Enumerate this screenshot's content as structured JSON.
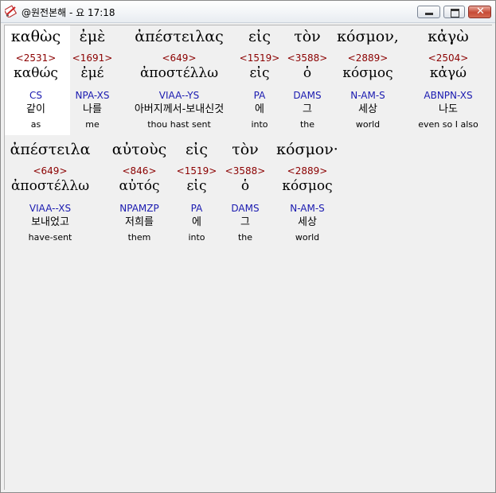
{
  "window": {
    "title": "@원전본해 - 요 17:18",
    "icon": "bible-app-icon",
    "buttons": {
      "minimize": "",
      "maximize": "",
      "close": "✕"
    }
  },
  "lines": [
    {
      "words": [
        {
          "greek": "καθὼς",
          "strong": "<2531>",
          "lemma": "καθώς",
          "morph": "CS",
          "korean": "같이",
          "english": "as"
        },
        {
          "greek": "ἐμὲ",
          "strong": "<1691>",
          "lemma": "ἐμέ",
          "morph": "NPA-XS",
          "korean": "나를",
          "english": "me"
        },
        {
          "greek": "ἀπέστειλας",
          "strong": "<649>",
          "lemma": "ἀποστέλλω",
          "morph": "VIAA--YS",
          "korean": "아버지께서-보내신것",
          "english": "thou hast sent"
        },
        {
          "greek": "εἰς",
          "strong": "<1519>",
          "lemma": "εἰς",
          "morph": "PA",
          "korean": "에",
          "english": "into"
        },
        {
          "greek": "τὸν",
          "strong": "<3588>",
          "lemma": "ὁ",
          "morph": "DAMS",
          "korean": "그",
          "english": "the"
        },
        {
          "greek": "κόσμον,",
          "strong": "<2889>",
          "lemma": "κόσμος",
          "morph": "N-AM-S",
          "korean": "세상",
          "english": "world"
        },
        {
          "greek": "κἀγὼ",
          "strong": "<2504>",
          "lemma": "κἀγώ",
          "morph": "ABNPN-XS",
          "korean": "나도",
          "english": "even so I also"
        }
      ]
    },
    {
      "words": [
        {
          "greek": "ἀπέστειλα",
          "strong": "<649>",
          "lemma": "ἀποστέλλω",
          "morph": "VIAA--XS",
          "korean": "보내었고",
          "english": "have-sent"
        },
        {
          "greek": "αὐτοὺς",
          "strong": "<846>",
          "lemma": "αὐτός",
          "morph": "NPAMZP",
          "korean": "저희를",
          "english": "them"
        },
        {
          "greek": "εἰς",
          "strong": "<1519>",
          "lemma": "εἰς",
          "morph": "PA",
          "korean": "에",
          "english": "into"
        },
        {
          "greek": "τὸν",
          "strong": "<3588>",
          "lemma": "ὁ",
          "morph": "DAMS",
          "korean": "그",
          "english": "the"
        },
        {
          "greek": "κόσμον·",
          "strong": "<2889>",
          "lemma": "κόσμος",
          "morph": "N-AM-S",
          "korean": "세상",
          "english": "world"
        }
      ]
    }
  ],
  "colors": {
    "strong": "#8b0000",
    "morph": "#1a1ab0",
    "selection": "#ffffff"
  }
}
